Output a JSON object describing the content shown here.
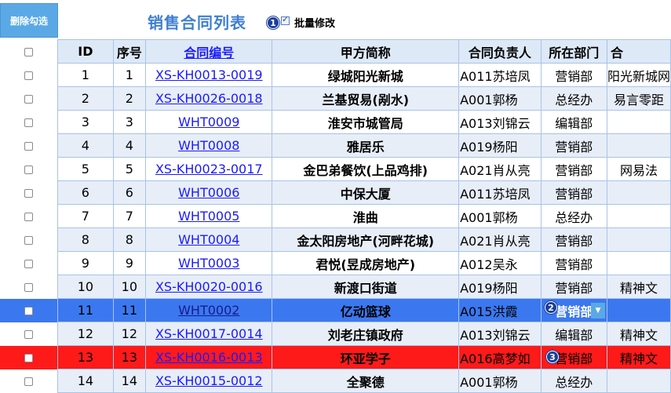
{
  "toolbar": {
    "delete_checked_label": "删除勾选"
  },
  "header": {
    "title": "销售合同列表",
    "bulk_edit_label": "批量修改",
    "bulk_edit_checked": true
  },
  "badges": {
    "b1": "1",
    "b2": "2",
    "b3": "3"
  },
  "columns": {
    "id": "ID",
    "seq": "序号",
    "contract_no": "合同编号",
    "party_a": "甲方简称",
    "owner": "合同负责人",
    "dept": "所在部门",
    "extra": "合"
  },
  "rows": [
    {
      "id": "1",
      "seq": "1",
      "contract_no": "XS-KH0013-0019",
      "party_a": "绿城阳光新城",
      "owner": "A011苏培凤",
      "dept": "营销部",
      "extra": "阳光新城网"
    },
    {
      "id": "2",
      "seq": "2",
      "contract_no": "XS-KH0026-0018",
      "party_a": "兰基贸易(剐水)",
      "owner": "A001郭杨",
      "dept": "总经办",
      "extra": "易言零距"
    },
    {
      "id": "3",
      "seq": "3",
      "contract_no": "WHT0009",
      "party_a": "淮安市城管局",
      "owner": "A013刘锦云",
      "dept": "编辑部",
      "extra": ""
    },
    {
      "id": "4",
      "seq": "4",
      "contract_no": "WHT0008",
      "party_a": "雅居乐",
      "owner": "A019杨阳",
      "dept": "营销部",
      "extra": ""
    },
    {
      "id": "5",
      "seq": "5",
      "contract_no": "XS-KH0023-0017",
      "party_a": "金巴弟餐饮(上品鸡排)",
      "owner": "A021肖从亮",
      "dept": "营销部",
      "extra": "网易法"
    },
    {
      "id": "6",
      "seq": "6",
      "contract_no": "WHT0006",
      "party_a": "中保大厦",
      "owner": "A011苏培凤",
      "dept": "营销部",
      "extra": ""
    },
    {
      "id": "7",
      "seq": "7",
      "contract_no": "WHT0005",
      "party_a": "淮曲",
      "owner": "A001郭杨",
      "dept": "总经办",
      "extra": ""
    },
    {
      "id": "8",
      "seq": "8",
      "contract_no": "WHT0004",
      "party_a": "金太阳房地产(河畔花城)",
      "owner": "A021肖从亮",
      "dept": "营销部",
      "extra": ""
    },
    {
      "id": "9",
      "seq": "9",
      "contract_no": "WHT0003",
      "party_a": "君悦(昱成房地产)",
      "owner": "A012吴永",
      "dept": "营销部",
      "extra": ""
    },
    {
      "id": "10",
      "seq": "10",
      "contract_no": "XS-KH0020-0016",
      "party_a": "新渡口街道",
      "owner": "A019杨阳",
      "dept": "营销部",
      "extra": "精神文"
    },
    {
      "id": "11",
      "seq": "11",
      "contract_no": "WHT0002",
      "party_a": "亿动篮球",
      "owner": "A015洪霞",
      "dept": "营销部",
      "extra": ""
    },
    {
      "id": "12",
      "seq": "12",
      "contract_no": "XS-KH0017-0014",
      "party_a": "刘老庄镇政府",
      "owner": "A013刘锦云",
      "dept": "编辑部",
      "extra": "精神文"
    },
    {
      "id": "13",
      "seq": "13",
      "contract_no": "XS-KH0016-0013",
      "party_a": "环亚学子",
      "owner": "A016高梦如",
      "dept": "营销部",
      "extra": "精神文"
    },
    {
      "id": "14",
      "seq": "14",
      "contract_no": "XS-KH0015-0012",
      "party_a": "全聚德",
      "owner": "A001郭杨",
      "dept": "总经办",
      "extra": ""
    }
  ],
  "colors": {
    "accent": "#3f7fd0",
    "selected_blue": "#3b78f0",
    "selected_red": "#ff1a1a",
    "header_bg": "#dde9f7",
    "alt_row": "#e7eef8"
  }
}
